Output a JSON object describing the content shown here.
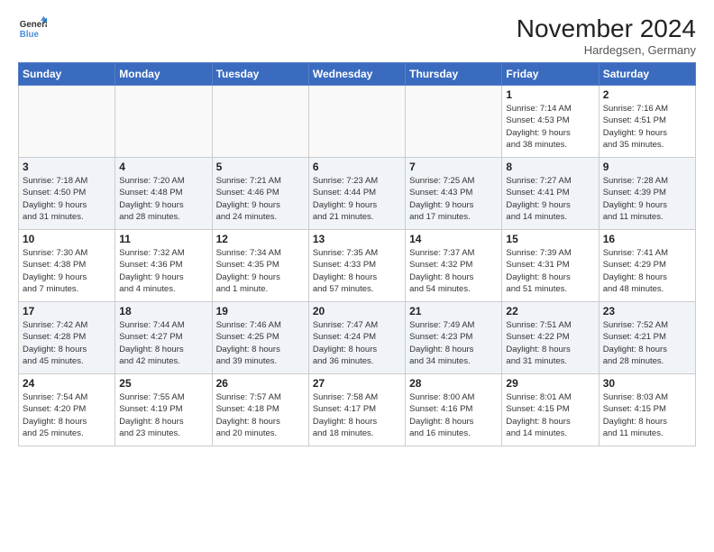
{
  "header": {
    "logo_line1": "General",
    "logo_line2": "Blue",
    "month": "November 2024",
    "location": "Hardegsen, Germany"
  },
  "weekdays": [
    "Sunday",
    "Monday",
    "Tuesday",
    "Wednesday",
    "Thursday",
    "Friday",
    "Saturday"
  ],
  "weeks": [
    [
      {
        "day": "",
        "info": ""
      },
      {
        "day": "",
        "info": ""
      },
      {
        "day": "",
        "info": ""
      },
      {
        "day": "",
        "info": ""
      },
      {
        "day": "",
        "info": ""
      },
      {
        "day": "1",
        "info": "Sunrise: 7:14 AM\nSunset: 4:53 PM\nDaylight: 9 hours\nand 38 minutes."
      },
      {
        "day": "2",
        "info": "Sunrise: 7:16 AM\nSunset: 4:51 PM\nDaylight: 9 hours\nand 35 minutes."
      }
    ],
    [
      {
        "day": "3",
        "info": "Sunrise: 7:18 AM\nSunset: 4:50 PM\nDaylight: 9 hours\nand 31 minutes."
      },
      {
        "day": "4",
        "info": "Sunrise: 7:20 AM\nSunset: 4:48 PM\nDaylight: 9 hours\nand 28 minutes."
      },
      {
        "day": "5",
        "info": "Sunrise: 7:21 AM\nSunset: 4:46 PM\nDaylight: 9 hours\nand 24 minutes."
      },
      {
        "day": "6",
        "info": "Sunrise: 7:23 AM\nSunset: 4:44 PM\nDaylight: 9 hours\nand 21 minutes."
      },
      {
        "day": "7",
        "info": "Sunrise: 7:25 AM\nSunset: 4:43 PM\nDaylight: 9 hours\nand 17 minutes."
      },
      {
        "day": "8",
        "info": "Sunrise: 7:27 AM\nSunset: 4:41 PM\nDaylight: 9 hours\nand 14 minutes."
      },
      {
        "day": "9",
        "info": "Sunrise: 7:28 AM\nSunset: 4:39 PM\nDaylight: 9 hours\nand 11 minutes."
      }
    ],
    [
      {
        "day": "10",
        "info": "Sunrise: 7:30 AM\nSunset: 4:38 PM\nDaylight: 9 hours\nand 7 minutes."
      },
      {
        "day": "11",
        "info": "Sunrise: 7:32 AM\nSunset: 4:36 PM\nDaylight: 9 hours\nand 4 minutes."
      },
      {
        "day": "12",
        "info": "Sunrise: 7:34 AM\nSunset: 4:35 PM\nDaylight: 9 hours\nand 1 minute."
      },
      {
        "day": "13",
        "info": "Sunrise: 7:35 AM\nSunset: 4:33 PM\nDaylight: 8 hours\nand 57 minutes."
      },
      {
        "day": "14",
        "info": "Sunrise: 7:37 AM\nSunset: 4:32 PM\nDaylight: 8 hours\nand 54 minutes."
      },
      {
        "day": "15",
        "info": "Sunrise: 7:39 AM\nSunset: 4:31 PM\nDaylight: 8 hours\nand 51 minutes."
      },
      {
        "day": "16",
        "info": "Sunrise: 7:41 AM\nSunset: 4:29 PM\nDaylight: 8 hours\nand 48 minutes."
      }
    ],
    [
      {
        "day": "17",
        "info": "Sunrise: 7:42 AM\nSunset: 4:28 PM\nDaylight: 8 hours\nand 45 minutes."
      },
      {
        "day": "18",
        "info": "Sunrise: 7:44 AM\nSunset: 4:27 PM\nDaylight: 8 hours\nand 42 minutes."
      },
      {
        "day": "19",
        "info": "Sunrise: 7:46 AM\nSunset: 4:25 PM\nDaylight: 8 hours\nand 39 minutes."
      },
      {
        "day": "20",
        "info": "Sunrise: 7:47 AM\nSunset: 4:24 PM\nDaylight: 8 hours\nand 36 minutes."
      },
      {
        "day": "21",
        "info": "Sunrise: 7:49 AM\nSunset: 4:23 PM\nDaylight: 8 hours\nand 34 minutes."
      },
      {
        "day": "22",
        "info": "Sunrise: 7:51 AM\nSunset: 4:22 PM\nDaylight: 8 hours\nand 31 minutes."
      },
      {
        "day": "23",
        "info": "Sunrise: 7:52 AM\nSunset: 4:21 PM\nDaylight: 8 hours\nand 28 minutes."
      }
    ],
    [
      {
        "day": "24",
        "info": "Sunrise: 7:54 AM\nSunset: 4:20 PM\nDaylight: 8 hours\nand 25 minutes."
      },
      {
        "day": "25",
        "info": "Sunrise: 7:55 AM\nSunset: 4:19 PM\nDaylight: 8 hours\nand 23 minutes."
      },
      {
        "day": "26",
        "info": "Sunrise: 7:57 AM\nSunset: 4:18 PM\nDaylight: 8 hours\nand 20 minutes."
      },
      {
        "day": "27",
        "info": "Sunrise: 7:58 AM\nSunset: 4:17 PM\nDaylight: 8 hours\nand 18 minutes."
      },
      {
        "day": "28",
        "info": "Sunrise: 8:00 AM\nSunset: 4:16 PM\nDaylight: 8 hours\nand 16 minutes."
      },
      {
        "day": "29",
        "info": "Sunrise: 8:01 AM\nSunset: 4:15 PM\nDaylight: 8 hours\nand 14 minutes."
      },
      {
        "day": "30",
        "info": "Sunrise: 8:03 AM\nSunset: 4:15 PM\nDaylight: 8 hours\nand 11 minutes."
      }
    ]
  ]
}
